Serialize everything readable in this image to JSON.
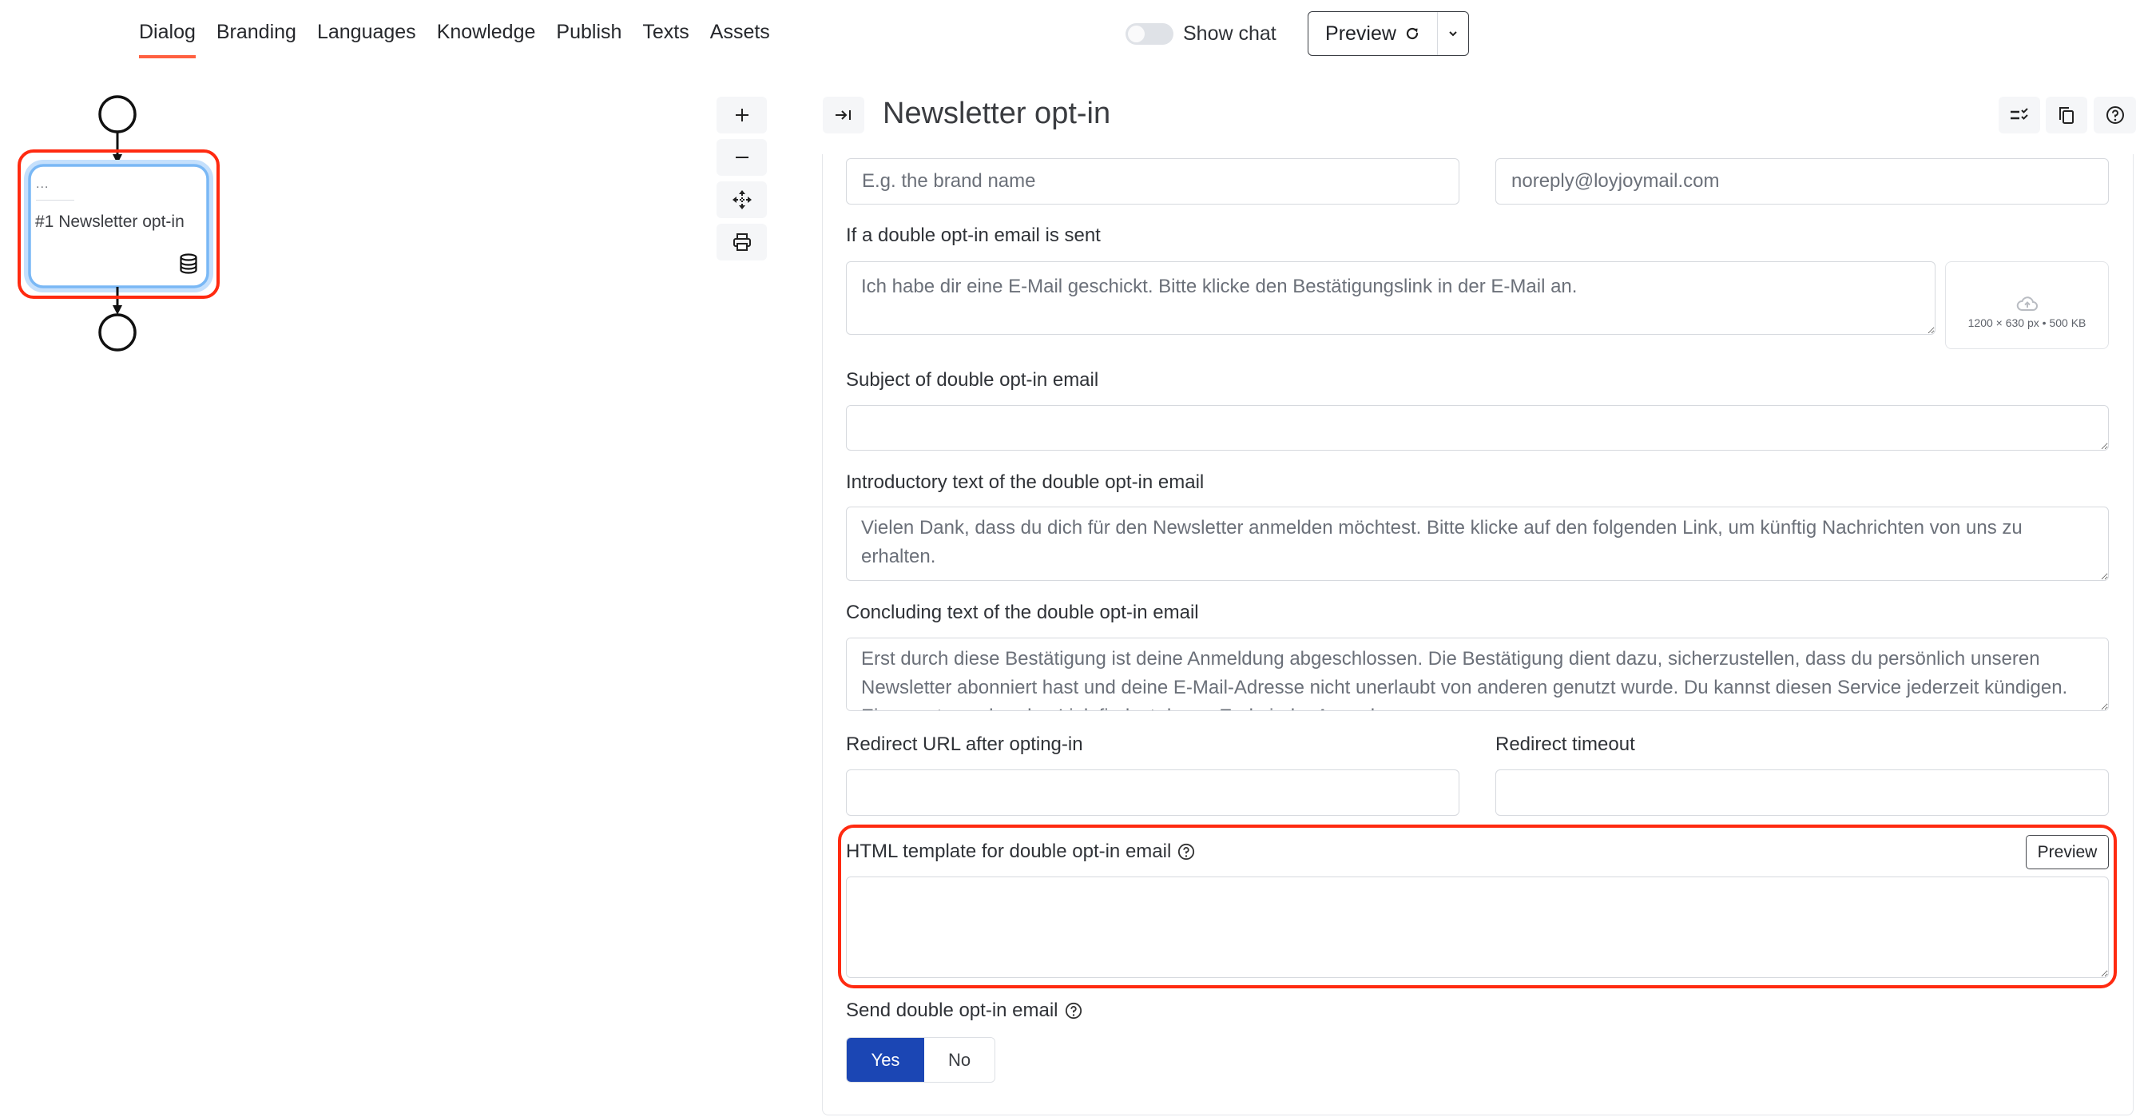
{
  "nav": {
    "tabs": [
      {
        "label": "Dialog",
        "active": true
      },
      {
        "label": "Branding",
        "active": false
      },
      {
        "label": "Languages",
        "active": false
      },
      {
        "label": "Knowledge",
        "active": false
      },
      {
        "label": "Publish",
        "active": false
      },
      {
        "label": "Texts",
        "active": false
      },
      {
        "label": "Assets",
        "active": false
      }
    ],
    "show_chat_label": "Show chat",
    "show_chat_on": false,
    "preview_label": "Preview",
    "preview_icon": "refresh-icon",
    "preview_dropdown_icon": "chevron-down-icon"
  },
  "diagram": {
    "node": {
      "dots": "...",
      "label": "#1 Newsletter opt-in",
      "icon": "database-icon"
    },
    "start_node": "start-circle",
    "end_node": "end-circle"
  },
  "canvas_controls": [
    {
      "name": "zoom-in",
      "icon": "plus-icon"
    },
    {
      "name": "zoom-out",
      "icon": "minus-icon"
    },
    {
      "name": "fit-view",
      "icon": "move-arrows-icon"
    },
    {
      "name": "print",
      "icon": "printer-icon"
    }
  ],
  "panel": {
    "title": "Newsletter opt-in",
    "collapse_icon": "collapse-right-icon",
    "header_actions": [
      {
        "name": "checklist",
        "icon": "checklist-icon"
      },
      {
        "name": "copy",
        "icon": "copy-icon"
      },
      {
        "name": "help",
        "icon": "help-circle-icon"
      }
    ],
    "fields": {
      "sender_name": {
        "placeholder": "E.g. the brand name",
        "value": ""
      },
      "sender_email": {
        "value": "noreply@loyjoymail.com"
      },
      "sent_message": {
        "label": "If a double opt-in email is sent",
        "value": "Ich habe dir eine E-Mail geschickt. Bitte klicke den Bestätigungslink in der E-Mail an."
      },
      "upload": {
        "hint": "1200 × 630 px • 500 KB",
        "icon": "cloud-upload-icon"
      },
      "subject": {
        "label": "Subject of double opt-in email",
        "value": ""
      },
      "intro": {
        "label": "Introductory text of the double opt-in email",
        "value": "Vielen Dank, dass du dich für den Newsletter anmelden möchtest. Bitte klicke auf den folgenden Link, um künftig Nachrichten von uns zu erhalten."
      },
      "concluding": {
        "label": "Concluding text of the double opt-in email",
        "value": "Erst durch diese Bestätigung ist deine Anmeldung abgeschlossen. Die Bestätigung dient dazu, sicherzustellen, dass du persönlich unseren Newsletter abonniert hast und deine E-Mail-Adresse nicht unerlaubt von anderen genutzt wurde. Du kannst diesen Service jederzeit kündigen. Einen entsprechenden Link findest du am Ende jeder Ausgabe."
      },
      "redirect_url": {
        "label": "Redirect URL after opting-in",
        "value": ""
      },
      "redirect_timeout": {
        "label": "Redirect timeout",
        "value": ""
      },
      "html_template": {
        "label": "HTML template for double opt-in email",
        "preview_label": "Preview",
        "value": ""
      },
      "send_email": {
        "label": "Send double opt-in email",
        "options": [
          "Yes",
          "No"
        ],
        "selected": "Yes"
      }
    }
  },
  "colors": {
    "accent_underline": "#ff6040",
    "highlight": "#ff2a10",
    "selected_primary": "#1b46b4",
    "node_border": "#7ab8f5"
  }
}
